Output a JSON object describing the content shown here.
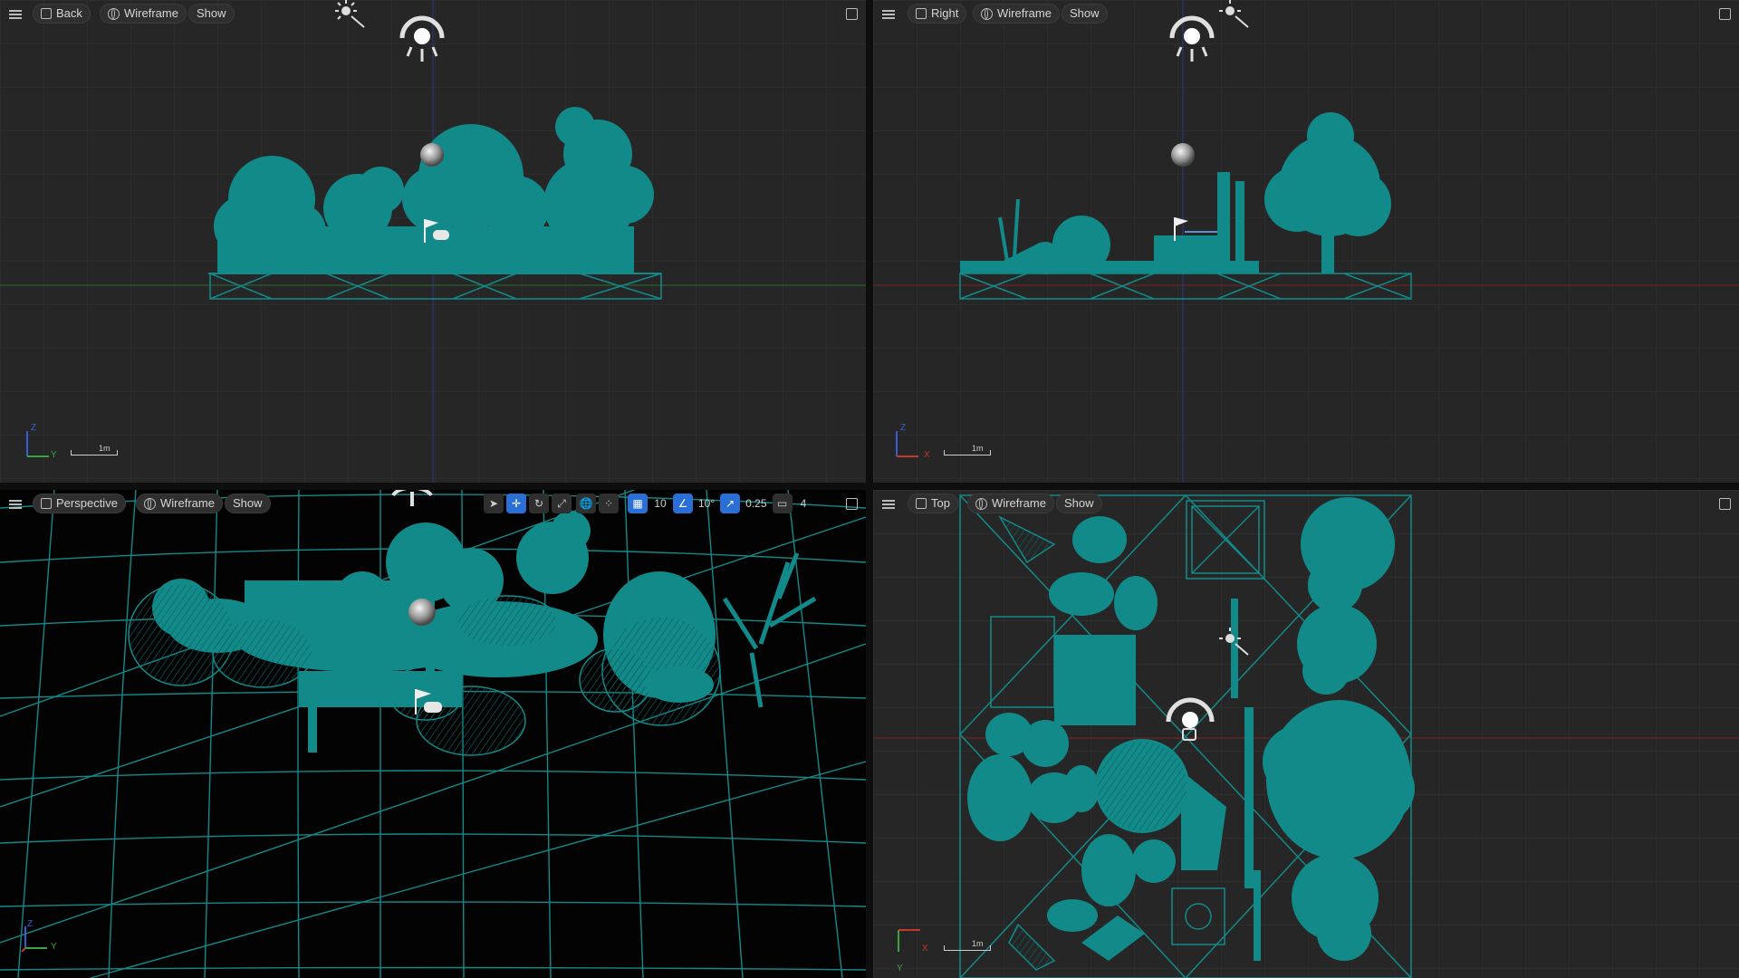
{
  "viewports": {
    "back": {
      "view_label": "Back",
      "mode_label": "Wireframe",
      "show_label": "Show",
      "axis_h": "Y",
      "axis_v": "Z",
      "scale_label": "1m"
    },
    "right": {
      "view_label": "Right",
      "mode_label": "Wireframe",
      "show_label": "Show",
      "axis_h": "X",
      "axis_v": "Z",
      "scale_label": "1m"
    },
    "perspective": {
      "view_label": "Perspective",
      "mode_label": "Wireframe",
      "show_label": "Show",
      "axis_h": "Y",
      "axis_v": "Z"
    },
    "top": {
      "view_label": "Top",
      "mode_label": "Wireframe",
      "show_label": "Show",
      "axis_h": "X",
      "axis_v": "Y",
      "scale_label": "1m"
    }
  },
  "perspective_toolbar": {
    "grid_snap": "10",
    "rotation_snap": "10°",
    "scale_snap": "0.25",
    "camera_speed": "4"
  },
  "icons": [
    "menu-icon",
    "cube-icon",
    "globe-icon",
    "maximize-icon",
    "select-icon",
    "move-icon",
    "rotate-icon",
    "scale-icon",
    "world-local-icon",
    "surface-snap-icon",
    "grid-snap-icon",
    "rotation-snap-icon",
    "scale-snap-icon",
    "camera-speed-icon",
    "directional-light-icon",
    "skylight-icon",
    "player-start-icon",
    "sphere-reflection-icon"
  ],
  "colors": {
    "wireframe": "#138a8a",
    "viewport_bg": "#262626",
    "perspective_bg": "#030303",
    "accent_blue": "#2a6fd6",
    "axis_red": "#c0392b",
    "axis_green": "#3aa640",
    "axis_blue": "#3b5bd6"
  }
}
